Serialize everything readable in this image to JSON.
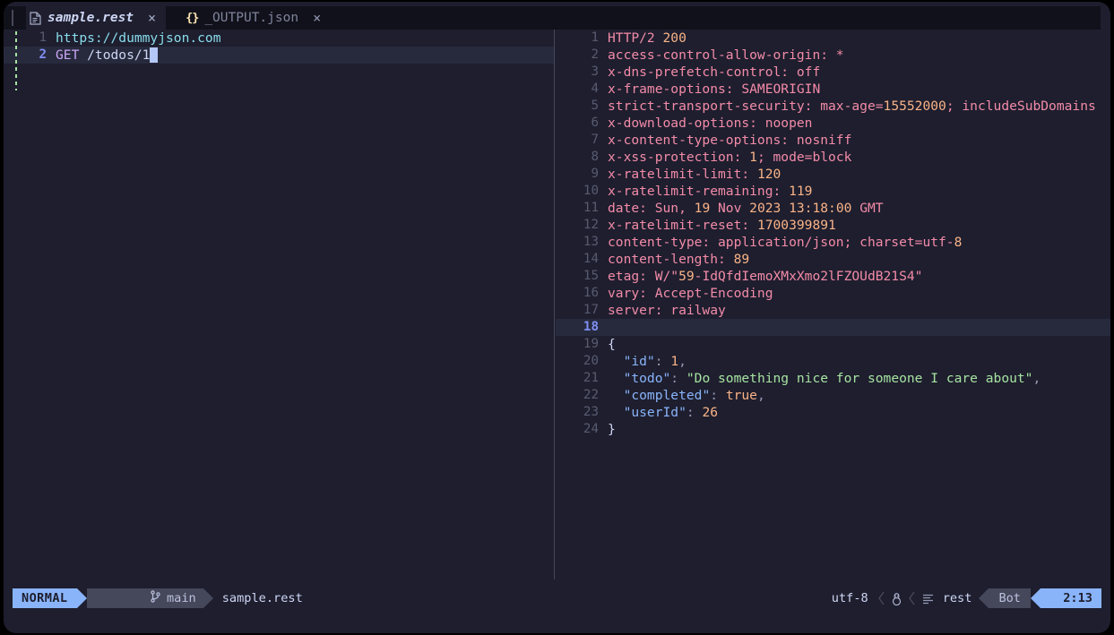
{
  "window": {
    "background": "#1e1e2e",
    "tabline_background": "#11111b"
  },
  "tabs": [
    {
      "icon": "file-document-icon",
      "label": "sample.rest",
      "close_label": "×",
      "active": true
    },
    {
      "icon": "json-braces-icon",
      "icon_text": "{}",
      "label": "_OUTPUT.json",
      "close_label": "×",
      "active": false
    }
  ],
  "editor": {
    "left_pane": {
      "name": "sample.rest",
      "cursor_line": 2,
      "lines": [
        {
          "num": "1",
          "tokens": [
            {
              "text": "https://dummyjson.com",
              "cls": "c-url"
            }
          ]
        },
        {
          "num": "2",
          "tokens": [
            {
              "text": "GET",
              "cls": "c-method"
            },
            {
              "text": " /todos/1",
              "cls": "c-path"
            }
          ],
          "cursor": true
        }
      ]
    },
    "right_pane": {
      "name": "_OUTPUT.json",
      "cursor_line": 18,
      "lines": [
        {
          "num": "1",
          "tokens": [
            {
              "text": "HTTP/2 ",
              "cls": "c-header"
            },
            {
              "text": "200",
              "cls": "c-num"
            }
          ]
        },
        {
          "num": "2",
          "tokens": [
            {
              "text": "access-control-allow-origin: *",
              "cls": "c-header"
            }
          ]
        },
        {
          "num": "3",
          "tokens": [
            {
              "text": "x-dns-prefetch-control: off",
              "cls": "c-header"
            }
          ]
        },
        {
          "num": "4",
          "tokens": [
            {
              "text": "x-frame-options: SAMEORIGIN",
              "cls": "c-header"
            }
          ]
        },
        {
          "num": "5",
          "tokens": [
            {
              "text": "strict-transport-security: max-age=",
              "cls": "c-header"
            },
            {
              "text": "15552000",
              "cls": "c-num"
            },
            {
              "text": "; includeSubDomains",
              "cls": "c-header"
            }
          ]
        },
        {
          "num": "6",
          "tokens": [
            {
              "text": "x-download-options: noopen",
              "cls": "c-header"
            }
          ]
        },
        {
          "num": "7",
          "tokens": [
            {
              "text": "x-content-type-options: nosniff",
              "cls": "c-header"
            }
          ]
        },
        {
          "num": "8",
          "tokens": [
            {
              "text": "x-xss-protection: ",
              "cls": "c-header"
            },
            {
              "text": "1",
              "cls": "c-num"
            },
            {
              "text": "; mode=block",
              "cls": "c-header"
            }
          ]
        },
        {
          "num": "9",
          "tokens": [
            {
              "text": "x-ratelimit-limit: ",
              "cls": "c-header"
            },
            {
              "text": "120",
              "cls": "c-num"
            }
          ]
        },
        {
          "num": "10",
          "tokens": [
            {
              "text": "x-ratelimit-remaining: ",
              "cls": "c-header"
            },
            {
              "text": "119",
              "cls": "c-num"
            }
          ]
        },
        {
          "num": "11",
          "tokens": [
            {
              "text": "date: Sun, ",
              "cls": "c-header"
            },
            {
              "text": "19",
              "cls": "c-num"
            },
            {
              "text": " Nov ",
              "cls": "c-header"
            },
            {
              "text": "2023 13:18:00",
              "cls": "c-num"
            },
            {
              "text": " GMT",
              "cls": "c-header"
            }
          ]
        },
        {
          "num": "12",
          "tokens": [
            {
              "text": "x-ratelimit-reset: ",
              "cls": "c-header"
            },
            {
              "text": "1700399891",
              "cls": "c-num"
            }
          ]
        },
        {
          "num": "13",
          "tokens": [
            {
              "text": "content-type: application/json; charset=utf-",
              "cls": "c-header"
            },
            {
              "text": "8",
              "cls": "c-num"
            }
          ]
        },
        {
          "num": "14",
          "tokens": [
            {
              "text": "content-length: ",
              "cls": "c-header"
            },
            {
              "text": "89",
              "cls": "c-num"
            }
          ]
        },
        {
          "num": "15",
          "tokens": [
            {
              "text": "etag: W/\"",
              "cls": "c-header"
            },
            {
              "text": "59",
              "cls": "c-num"
            },
            {
              "text": "-IdQfdIemoXMxXmo2lFZOUdB21S4\"",
              "cls": "c-header"
            }
          ]
        },
        {
          "num": "16",
          "tokens": [
            {
              "text": "vary: Accept-Encoding",
              "cls": "c-header"
            }
          ]
        },
        {
          "num": "17",
          "tokens": [
            {
              "text": "server: railway",
              "cls": "c-header"
            }
          ]
        },
        {
          "num": "18",
          "tokens": [
            {
              "text": "",
              "cls": "c-plain"
            }
          ],
          "cursor": true
        },
        {
          "num": "19",
          "tokens": [
            {
              "text": "{",
              "cls": "c-plain"
            }
          ]
        },
        {
          "num": "20",
          "tokens": [
            {
              "text": "  ",
              "cls": "c-plain"
            },
            {
              "text": "\"id\"",
              "cls": "c-key"
            },
            {
              "text": ": ",
              "cls": "c-punct"
            },
            {
              "text": "1",
              "cls": "c-num"
            },
            {
              "text": ",",
              "cls": "c-punct"
            }
          ]
        },
        {
          "num": "21",
          "tokens": [
            {
              "text": "  ",
              "cls": "c-plain"
            },
            {
              "text": "\"todo\"",
              "cls": "c-key"
            },
            {
              "text": ": ",
              "cls": "c-punct"
            },
            {
              "text": "\"Do something nice for someone I care about\"",
              "cls": "c-str"
            },
            {
              "text": ",",
              "cls": "c-punct"
            }
          ]
        },
        {
          "num": "22",
          "tokens": [
            {
              "text": "  ",
              "cls": "c-plain"
            },
            {
              "text": "\"completed\"",
              "cls": "c-key"
            },
            {
              "text": ": ",
              "cls": "c-punct"
            },
            {
              "text": "true",
              "cls": "c-bool"
            },
            {
              "text": ",",
              "cls": "c-punct"
            }
          ]
        },
        {
          "num": "23",
          "tokens": [
            {
              "text": "  ",
              "cls": "c-plain"
            },
            {
              "text": "\"userId\"",
              "cls": "c-key"
            },
            {
              "text": ": ",
              "cls": "c-punct"
            },
            {
              "text": "26",
              "cls": "c-num"
            }
          ]
        },
        {
          "num": "24",
          "tokens": [
            {
              "text": "}",
              "cls": "c-plain"
            }
          ]
        }
      ]
    }
  },
  "statusline": {
    "mode": "NORMAL",
    "branch_icon": "git-branch-icon",
    "branch": "main",
    "filename": "sample.rest",
    "encoding": "utf-8",
    "os_icon": "linux-penguin-icon",
    "indent_icon": "indent-lines-icon",
    "filetype": "rest",
    "position": "Bot",
    "line_col": "2:13"
  },
  "colors": {
    "accent_blue": "#89b4fa",
    "surface": "#45475a",
    "base": "#1e1e2e",
    "mantle": "#11111b",
    "header_pink": "#f38ba8",
    "number_orange": "#fab387",
    "string_green": "#a6e3a1",
    "key_blue": "#89b4fa",
    "url_cyan": "#89dceb",
    "method_mauve": "#cba6f7",
    "gutter_git_green": "#a6e3a1"
  }
}
